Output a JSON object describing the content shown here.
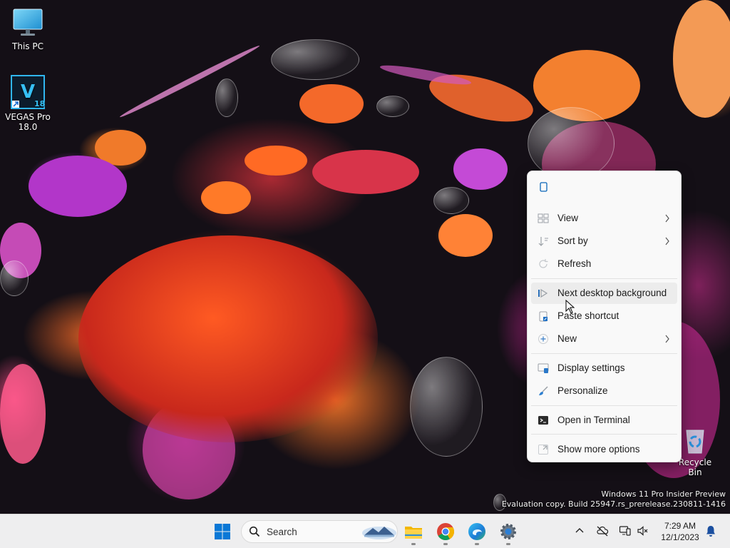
{
  "desktop_icons": [
    {
      "label": "This PC",
      "icon": "monitor-icon"
    },
    {
      "label": "VEGAS Pro 18.0",
      "icon": "vegas-pro-icon",
      "badge": "18",
      "letter": "V"
    },
    {
      "label": "Recycle Bin",
      "icon": "recycle-bin-icon"
    }
  ],
  "context_menu": {
    "top_icon": "copy-icon",
    "items": [
      {
        "label": "View",
        "icon": "grid-icon",
        "submenu": true
      },
      {
        "label": "Sort by",
        "icon": "sort-icon",
        "submenu": true
      },
      {
        "label": "Refresh",
        "icon": "refresh-icon",
        "submenu": false
      },
      {
        "label": "Next desktop background",
        "icon": "next-background-icon",
        "submenu": false,
        "hovered": true
      },
      {
        "label": "Paste shortcut",
        "icon": "paste-shortcut-icon",
        "submenu": false
      },
      {
        "label": "New",
        "icon": "plus-icon",
        "submenu": true
      },
      {
        "label": "Display settings",
        "icon": "display-icon",
        "submenu": false
      },
      {
        "label": "Personalize",
        "icon": "brush-icon",
        "submenu": false
      },
      {
        "label": "Open in Terminal",
        "icon": "terminal-icon",
        "submenu": false
      },
      {
        "label": "Show more options",
        "icon": "expand-icon",
        "submenu": false
      }
    ]
  },
  "watermark": {
    "line1": "Windows 11 Pro Insider Preview",
    "line2": "Evaluation copy. Build 25947.rs_prerelease.230811-1416"
  },
  "taskbar": {
    "search_placeholder": "Search",
    "apps": [
      "start-icon",
      "file-explorer-icon",
      "chrome-icon",
      "edge-icon",
      "settings-icon"
    ],
    "tray": [
      "chevron-up-icon",
      "cloud-offline-icon",
      "network-icon",
      "volume-muted-icon",
      "notification-bell-icon"
    ],
    "clock": {
      "time": "7:29 AM",
      "date": "12/1/2023"
    }
  },
  "colors": {
    "accent": "#0078d4",
    "taskbar": "#eeeeef",
    "menu_bg": "#f9f9f9"
  }
}
